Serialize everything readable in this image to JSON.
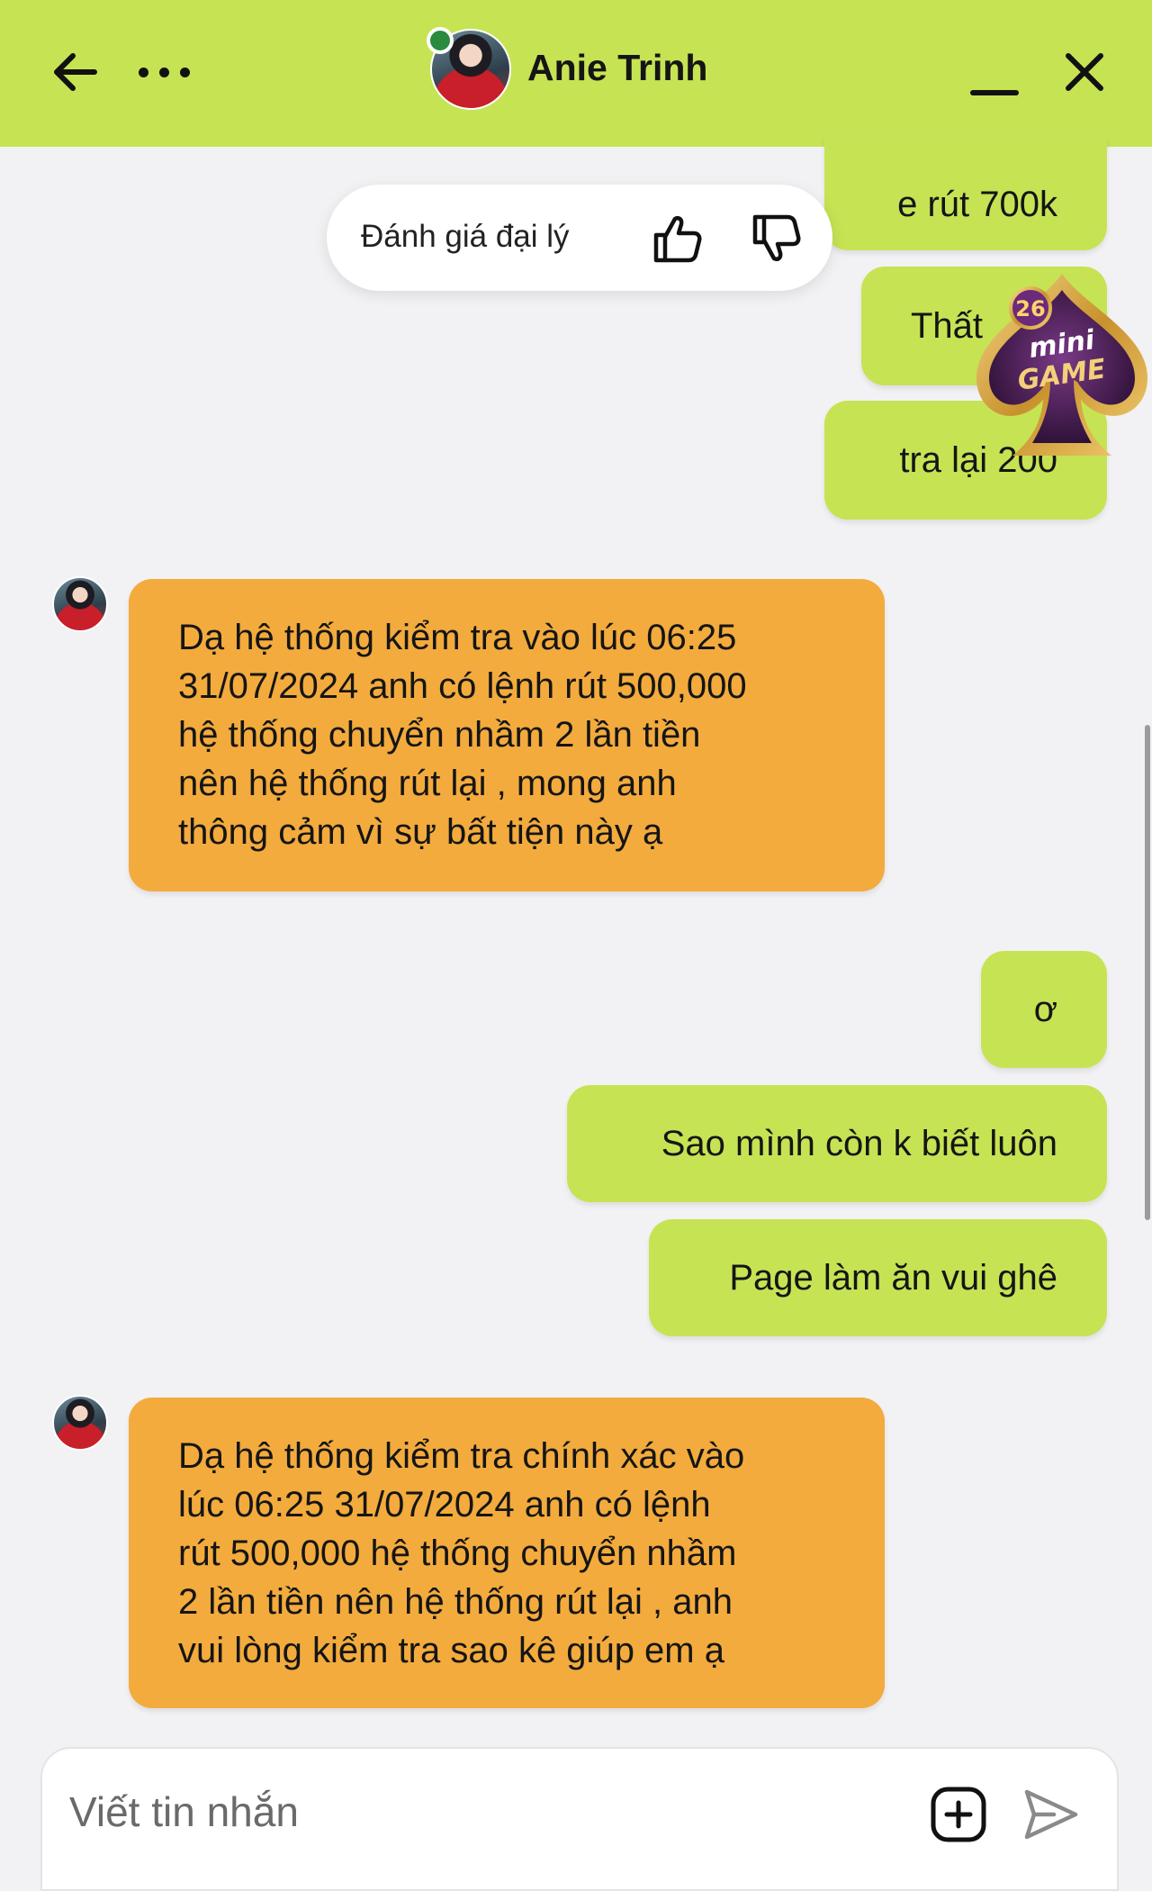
{
  "header": {
    "contact_name": "Anie Trinh",
    "status": "online"
  },
  "rating": {
    "label": "Đánh giá đại lý"
  },
  "messages": [
    {
      "from": "me",
      "text": "e rút 700k"
    },
    {
      "from": "me",
      "text": "Thất "
    },
    {
      "from": "me",
      "text": "tra lại 200"
    },
    {
      "from": "agent",
      "text": "Dạ hệ thống kiểm tra vào lúc 06:25\n31/07/2024 anh có lệnh rút 500,000\nhệ thống chuyển nhầm 2 lần tiền\nnên hệ thống rút lại , mong anh\nthông cảm vì sự bất tiện này ạ"
    },
    {
      "from": "me",
      "text": "ơ"
    },
    {
      "from": "me",
      "text": "Sao mình còn k biết luôn"
    },
    {
      "from": "me",
      "text": "Page làm ăn vui ghê"
    },
    {
      "from": "agent",
      "text": "Dạ hệ thống kiểm tra chính xác vào\nlúc 06:25 31/07/2024 anh có lệnh\nrút 500,000 hệ thống chuyển nhầm\n2 lần tiền nên hệ thống rút lại , anh\nvui lòng kiểm tra sao kê giúp em ạ"
    }
  ],
  "badge": {
    "number": "26",
    "line1": "mini",
    "line2": "GAME"
  },
  "composer": {
    "placeholder": "Viết tin nhắn"
  },
  "colors": {
    "accent": "#c6e354",
    "agent_bubble": "#f3ab3d",
    "background": "#f2f2f4"
  }
}
